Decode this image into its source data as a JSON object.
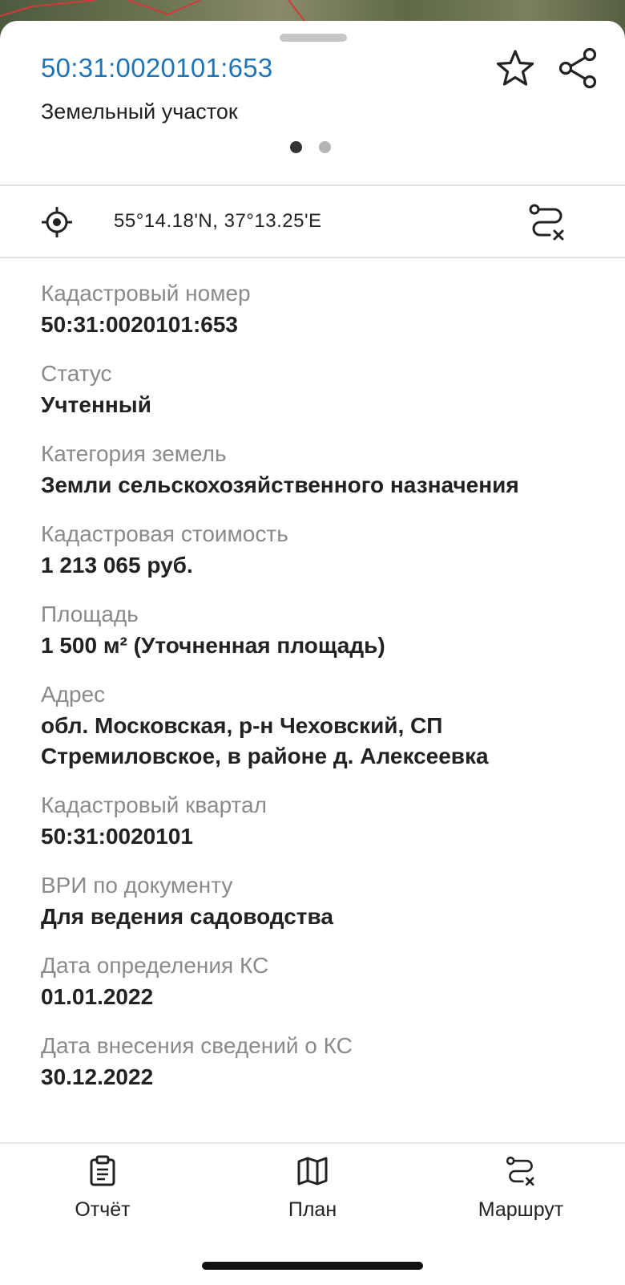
{
  "header": {
    "cadastral_title": "50:31:0020101:653",
    "object_type": "Земельный участок",
    "icons": {
      "favorite": "star-outline-icon",
      "share": "share-icon"
    },
    "pager": {
      "count": 2,
      "active": 1
    }
  },
  "location": {
    "icon": "target-icon",
    "coordinates": "55°14.18'N, 37°13.25'E",
    "route_icon": "route-cancel-icon"
  },
  "fields": [
    {
      "label": "Кадастровый номер",
      "value": "50:31:0020101:653"
    },
    {
      "label": "Статус",
      "value": "Учтенный"
    },
    {
      "label": "Категория земель",
      "value": "Земли сельскохозяйственного назначения"
    },
    {
      "label": "Кадастровая стоимость",
      "value": "1 213 065 руб."
    },
    {
      "label": "Площадь",
      "value": "1 500 м² (Уточненная площадь)"
    },
    {
      "label": "Адрес",
      "value": "обл. Московская, р-н Чеховский, СП Стремиловское, в районе д. Алексеевка"
    },
    {
      "label": "Кадастровый квартал",
      "value": "50:31:0020101"
    },
    {
      "label": "ВРИ по документу",
      "value": "Для ведения садоводства"
    },
    {
      "label": "Дата определения КС",
      "value": "01.01.2022"
    },
    {
      "label": "Дата внесения сведений о КС",
      "value": "30.12.2022"
    }
  ],
  "bottom_bar": {
    "report": {
      "label": "Отчёт",
      "icon": "clipboard-icon"
    },
    "plan": {
      "label": "План",
      "icon": "map-icon"
    },
    "route": {
      "label": "Маршрут",
      "icon": "route-icon"
    }
  },
  "colors": {
    "title_link": "#1f73b7",
    "label_gray": "#8a8a8a",
    "text_dark": "#222222"
  }
}
